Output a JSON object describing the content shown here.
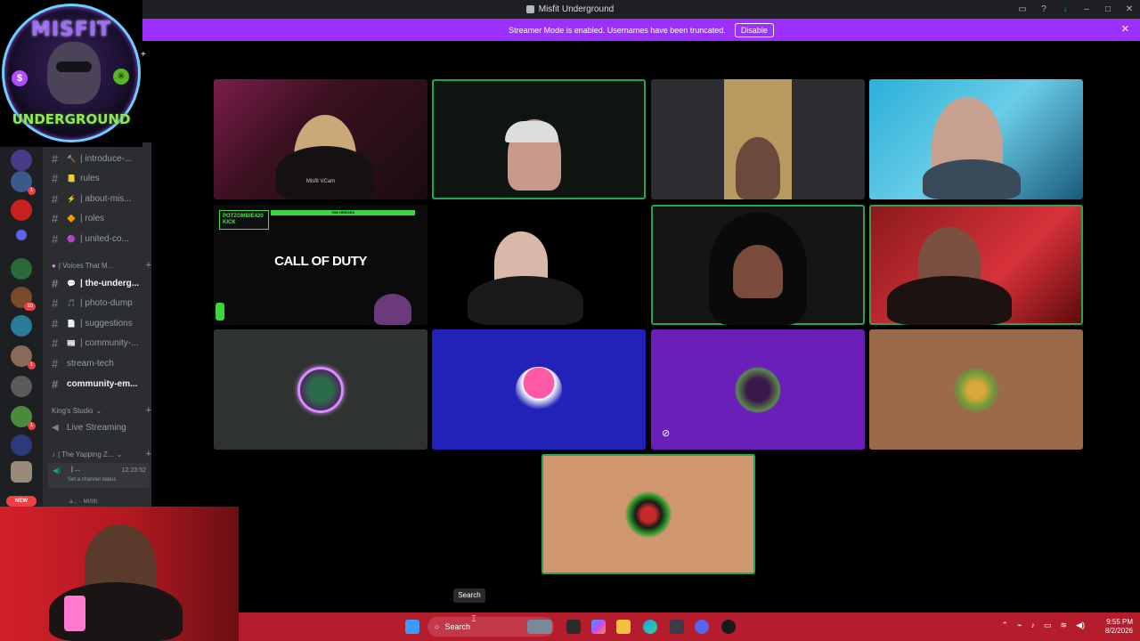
{
  "titlebar": {
    "title": "Misfit Underground",
    "corner": "AI",
    "actions": [
      "▭",
      "?",
      "↓",
      "–",
      "□",
      "✕"
    ]
  },
  "banner": {
    "text": "Streamer Mode is enabled. Usernames have been truncated.",
    "disable_label": "Disable",
    "close": "✕"
  },
  "logo": {
    "top": "MISFIT",
    "bottom": "UNDERGROUND",
    "dollar": "$",
    "leaf": "✳"
  },
  "rail": {
    "badges": [
      "1",
      "1",
      "10",
      "1",
      "1"
    ],
    "new": "NEW"
  },
  "channels": {
    "items": [
      {
        "label": "| introduce-...",
        "emoji": "🔨"
      },
      {
        "label": "rules",
        "emoji": "📒"
      },
      {
        "label": "| about-mis...",
        "emoji": "⚡"
      },
      {
        "label": "| roles",
        "emoji": "🔶"
      },
      {
        "label": "| united-co...",
        "emoji": "🟣"
      }
    ],
    "category1": "| Voices That M...",
    "items2": [
      {
        "label": "| the-underg...",
        "emoji": "💬"
      },
      {
        "label": "| photo-dump",
        "emoji": "🎵"
      },
      {
        "label": "| suggestions",
        "emoji": "📄"
      },
      {
        "label": "| community-...",
        "emoji": "📰"
      },
      {
        "label": "stream-tech",
        "emoji": ""
      },
      {
        "label": "community-em...",
        "emoji": ""
      }
    ],
    "category2": "King's Studio",
    "live": "Live Streaming",
    "category3": "| The Yapping Z...",
    "voice_user": {
      "name": "| ...",
      "time": "12:23:52",
      "status": "Set a channel status"
    },
    "voice_user2": "a... ·· MISfit"
  },
  "grid": {
    "cod_title": "CALL OF DUTY",
    "cod_tag": "POTZOMBIE420 KICK",
    "cod_header": "THE HEROES",
    "tile1_lbl": "Misfit VCam"
  },
  "taskbar": {
    "search": "Search",
    "tooltip": "Search",
    "time": "9:55 PM",
    "date": "8/2/2026"
  }
}
